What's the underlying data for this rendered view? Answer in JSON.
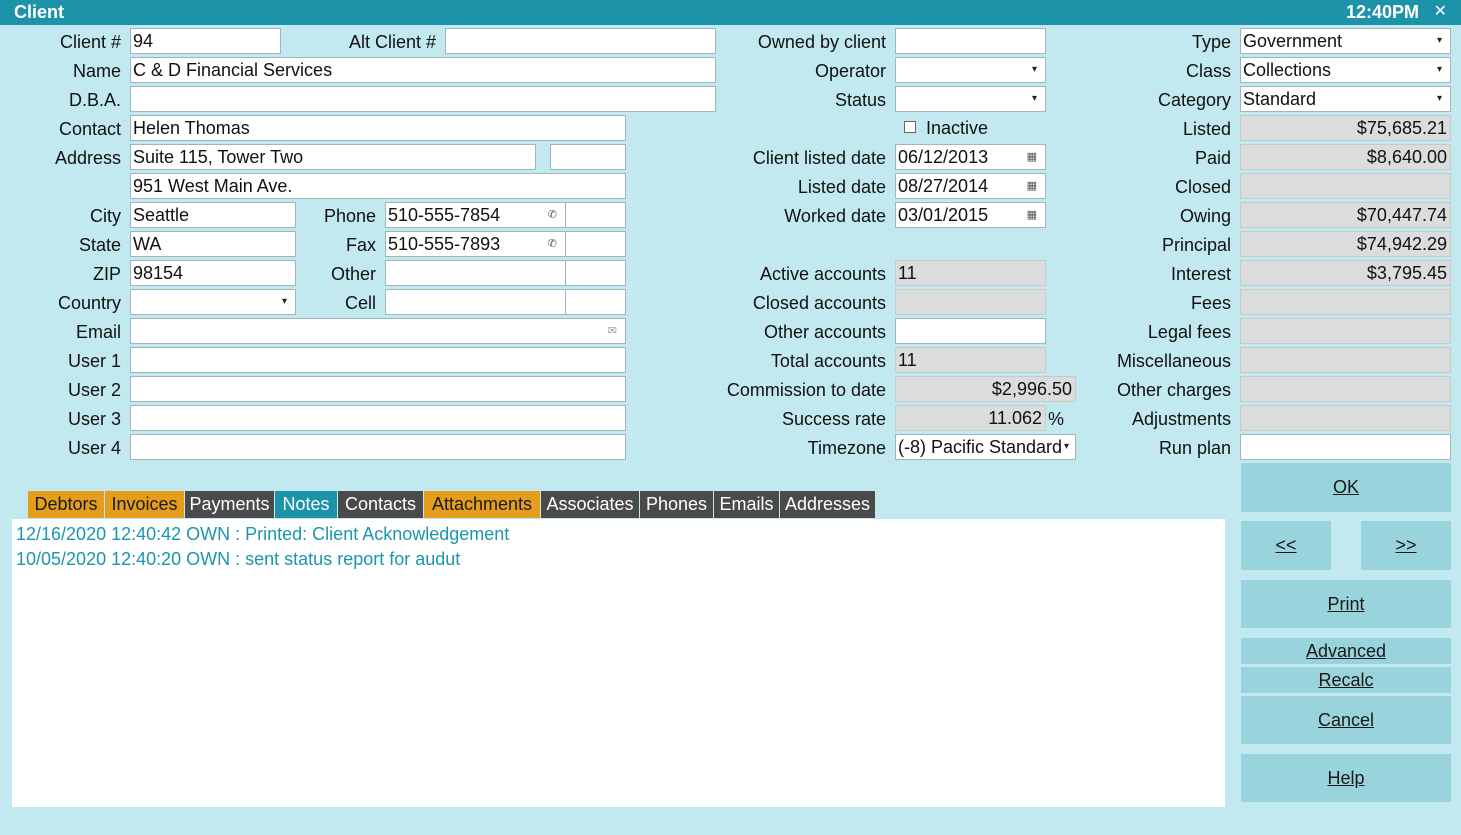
{
  "window": {
    "title": "Client",
    "clock": "12:40PM",
    "close": "✕"
  },
  "left": {
    "client_no_label": "Client #",
    "client_no": "94",
    "alt_client_label": "Alt Client #",
    "alt_client": "",
    "name_label": "Name",
    "name": "C & D Financial Services",
    "dba_label": "D.B.A.",
    "dba": "",
    "contact_label": "Contact",
    "contact": "Helen Thomas",
    "address_label": "Address",
    "address1": "Suite 115, Tower Two",
    "address_extra": "",
    "address2": "951 West Main Ave.",
    "city_label": "City",
    "city": "Seattle",
    "state_label": "State",
    "state": "WA",
    "zip_label": "ZIP",
    "zip": "98154",
    "country_label": "Country",
    "country": "",
    "phone_label": "Phone",
    "phone": "510-555-7854",
    "phone_ext": "",
    "fax_label": "Fax",
    "fax": "510-555-7893",
    "fax_ext": "",
    "other_label": "Other",
    "other": "",
    "other_ext": "",
    "cell_label": "Cell",
    "cell": "",
    "cell_ext": "",
    "email_label": "Email",
    "email": "",
    "user1_label": "User 1",
    "user1": "",
    "user2_label": "User 2",
    "user2": "",
    "user3_label": "User 3",
    "user3": "",
    "user4_label": "User 4",
    "user4": ""
  },
  "middle": {
    "owned_label": "Owned by client",
    "owned": "",
    "operator_label": "Operator",
    "operator": "",
    "status_label": "Status",
    "status": "",
    "inactive_label": "Inactive",
    "client_listed_label": "Client listed date",
    "client_listed": "06/12/2013",
    "listed_date_label": "Listed date",
    "listed_date": "08/27/2014",
    "worked_label": "Worked date",
    "worked": "03/01/2015",
    "active_label": "Active accounts",
    "active": "11",
    "closed_label": "Closed accounts",
    "closed": "",
    "other_acc_label": "Other accounts",
    "other_acc": "",
    "total_label": "Total accounts",
    "total": "11",
    "commission_label": "Commission to date",
    "commission": "$2,996.50",
    "success_label": "Success rate",
    "success": "11.062",
    "percent": "%",
    "timezone_label": "Timezone",
    "timezone": "(-8) Pacific Standard"
  },
  "right": {
    "type_label": "Type",
    "type": "Government",
    "class_label": "Class",
    "class": "Collections",
    "category_label": "Category",
    "category": "Standard",
    "listed_label": "Listed",
    "listed": "$75,685.21",
    "paid_label": "Paid",
    "paid": "$8,640.00",
    "closed_label": "Closed",
    "closed": "",
    "owing_label": "Owing",
    "owing": "$70,447.74",
    "principal_label": "Principal",
    "principal": "$74,942.29",
    "interest_label": "Interest",
    "interest": "$3,795.45",
    "fees_label": "Fees",
    "fees": "",
    "legal_label": "Legal fees",
    "legal": "",
    "misc_label": "Miscellaneous",
    "misc": "",
    "other_charges_label": "Other charges",
    "other_charges": "",
    "adjustments_label": "Adjustments",
    "adjustments": "",
    "runplan_label": "Run plan",
    "runplan": ""
  },
  "tabs": [
    "Debtors",
    "Invoices",
    "Payments",
    "Notes",
    "Contacts",
    "Attachments",
    "Associates",
    "Phones",
    "Emails",
    "Addresses"
  ],
  "notes": [
    "12/16/2020 12:40:42 OWN : Printed: Client Acknowledgement",
    "10/05/2020 12:40:20 OWN : sent status report for audut"
  ],
  "buttons": {
    "ok": "OK",
    "prev": "<<",
    "next": ">>",
    "print": "Print",
    "advanced": "Advanced",
    "recalc": "Recalc",
    "cancel": "Cancel",
    "help": "Help"
  },
  "icons": {
    "dropdown": "▾",
    "phone": "✆",
    "calendar": "▦",
    "email": "✉"
  },
  "colors": {
    "background": "#c3e9f0",
    "titlebar": "#1c93a8",
    "tab_orange": "#e59e1c",
    "tab_dark": "#4a4a4a",
    "button": "#99d3dc",
    "note_text": "#1b96ab"
  }
}
